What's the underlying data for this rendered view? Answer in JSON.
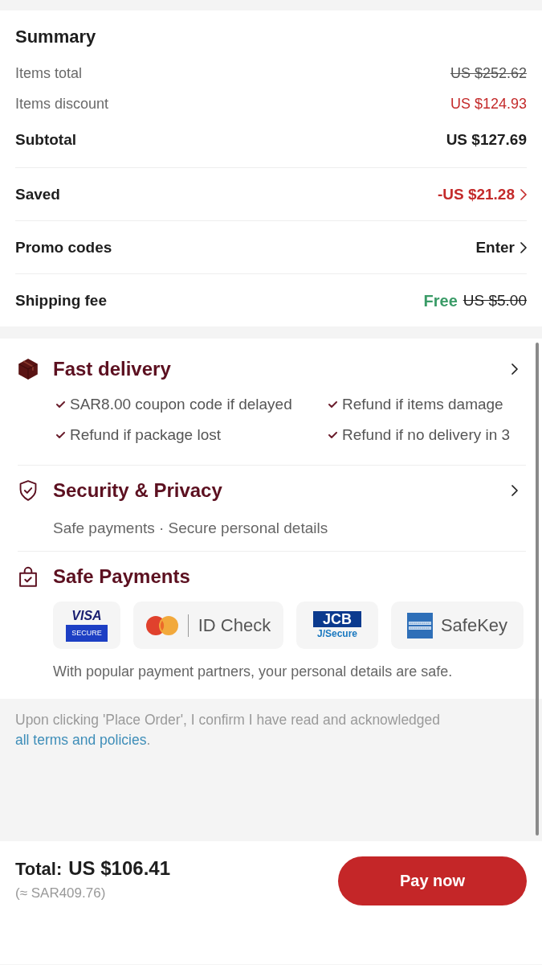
{
  "summary": {
    "title": "Summary",
    "groups": [
      {
        "rows": [
          {
            "kind": "struck",
            "label": "Items total",
            "value": "US $252.62",
            "chevron": false
          },
          {
            "kind": "discount",
            "label": "Items discount",
            "value": "US $124.93",
            "chevron": false
          },
          {
            "kind": "subtotal",
            "label": "Subtotal",
            "value": "US $127.69",
            "chevron": false
          }
        ]
      },
      {
        "rows": [
          {
            "kind": "savings",
            "label": "Saved",
            "value": "-US $21.28",
            "chevron": true
          }
        ]
      },
      {
        "rows": [
          {
            "kind": "action",
            "label": "Promo codes",
            "value": "Enter",
            "chevron": true
          }
        ]
      },
      {
        "rows": [
          {
            "kind": "free",
            "label": "Shipping fee",
            "value": "Free",
            "old_value": "US $5.00",
            "chevron": false
          }
        ]
      }
    ]
  },
  "protection": {
    "sections": [
      {
        "kind": "delivery",
        "title": "Fast delivery",
        "chevron": true,
        "benefits": [
          "SAR8.00 coupon code if delayed",
          "Refund if items damage",
          "Refund if package lost",
          "Refund if no delivery in 3"
        ]
      },
      {
        "kind": "security",
        "title": "Security & Privacy",
        "chevron": true,
        "subtitle": "Safe payments · Secure personal details"
      },
      {
        "kind": "payments",
        "title": "Safe Payments",
        "chevron": false,
        "partners": [
          {
            "kind": "visa",
            "brand": "VISA",
            "label": "SECURE"
          },
          {
            "kind": "mastercard",
            "label": "ID Check"
          },
          {
            "kind": "jcb",
            "brand": "JCB",
            "label": "J/Secure"
          },
          {
            "kind": "amex",
            "label": "SafeKey"
          }
        ],
        "note": "With popular payment partners, your personal details are safe."
      }
    ]
  },
  "terms": {
    "text": "Upon clicking 'Place Order', I confirm I have read and acknowledged",
    "link": "all terms and policies",
    "after": "."
  },
  "footer": {
    "total_label": "Total:",
    "total": "US $106.41",
    "converted": "(≈ SAR409.76)",
    "button": "Pay now"
  }
}
